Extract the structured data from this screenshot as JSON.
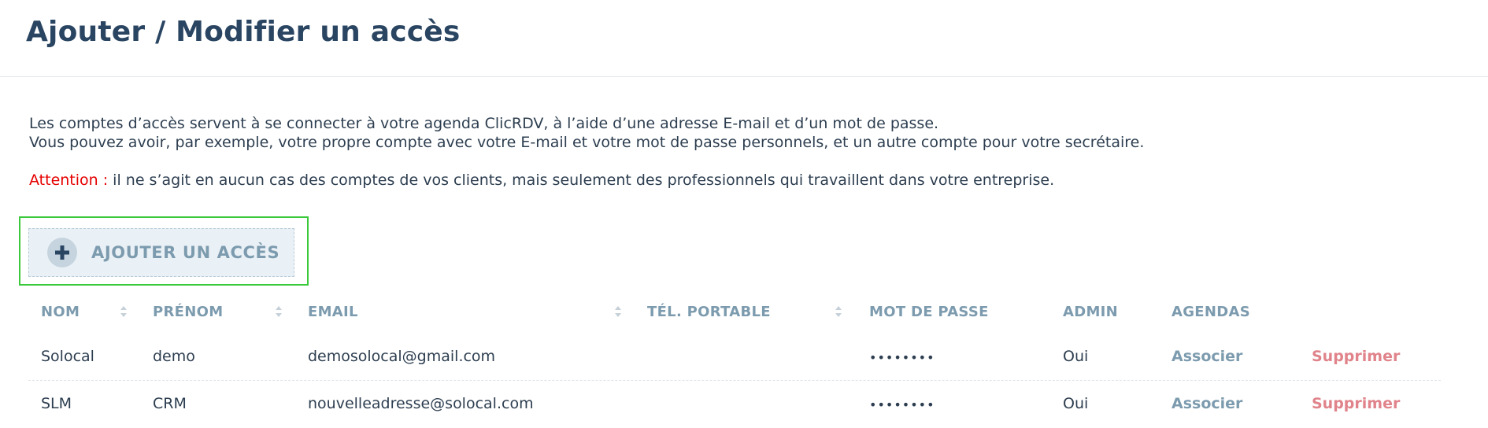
{
  "page": {
    "title": "Ajouter / Modifier un accès"
  },
  "intro": {
    "line1": "Les comptes d’accès servent à se connecter à votre agenda ClicRDV, à l’aide d’une adresse E-mail et d’un mot de passe.",
    "line2": "Vous pouvez avoir, par exemple, votre propre compte avec votre E-mail et votre mot de passe personnels, et un autre compte pour votre secrétaire.",
    "attention_label": "Attention :",
    "attention_text": " il ne s’agit en aucun cas des comptes de vos clients, mais seulement des professionnels qui travaillent dans votre entreprise."
  },
  "add_button": {
    "label": "AJOUTER UN ACCÈS",
    "icon": "plus-icon"
  },
  "table": {
    "columns": [
      "NOM",
      "PRÉNOM",
      "EMAIL",
      "TÉL. PORTABLE",
      "MOT DE PASSE",
      "ADMIN",
      "AGENDAS"
    ],
    "rows": [
      {
        "nom": "Solocal",
        "prenom": "demo",
        "email": "demosolocal@gmail.com",
        "tel": "",
        "password": "••••••••",
        "admin": "Oui",
        "associer": "Associer",
        "supprimer": "Supprimer"
      },
      {
        "nom": "SLM",
        "prenom": "CRM",
        "email": "nouvelleadresse@solocal.com",
        "tel": "",
        "password": "••••••••",
        "admin": "Oui",
        "associer": "Associer",
        "supprimer": "Supprimer"
      }
    ]
  },
  "colors": {
    "title": "#2a4562",
    "text": "#2d3e50",
    "muted": "#7c9bae",
    "attention": "#e60000",
    "delete": "#e0838a",
    "highlight": "#3ac93a"
  }
}
